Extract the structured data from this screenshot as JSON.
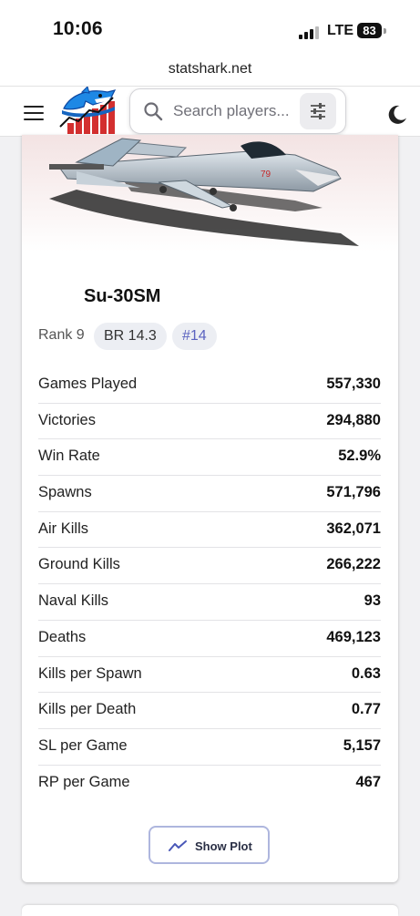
{
  "status_bar": {
    "time": "10:06",
    "network": "LTE",
    "battery": "83"
  },
  "browser": {
    "url": "statshark.net"
  },
  "header": {
    "menu_icon": "menu-icon",
    "logo_icon": "shark-logo-icon",
    "search": {
      "placeholder": "Search players...",
      "value": ""
    },
    "filter_icon": "sliders-icon",
    "theme_icon": "moon-icon"
  },
  "vehicle": {
    "name": "Su-30SM",
    "rank": "Rank 9",
    "br": "BR 14.3",
    "position": "#14"
  },
  "stats": [
    {
      "label": "Games Played",
      "value": "557,330"
    },
    {
      "label": "Victories",
      "value": "294,880"
    },
    {
      "label": "Win Rate",
      "value": "52.9%"
    },
    {
      "label": "Spawns",
      "value": "571,796"
    },
    {
      "label": "Air Kills",
      "value": "362,071"
    },
    {
      "label": "Ground Kills",
      "value": "266,222"
    },
    {
      "label": "Naval Kills",
      "value": "93"
    },
    {
      "label": "Deaths",
      "value": "469,123"
    },
    {
      "label": "Kills per Spawn",
      "value": "0.63"
    },
    {
      "label": "Kills per Death",
      "value": "0.77"
    },
    {
      "label": "SL per Game",
      "value": "5,157"
    },
    {
      "label": "RP per Game",
      "value": "467"
    }
  ],
  "plot_button": {
    "label": "Show Plot",
    "icon": "trend-line-icon"
  },
  "colors": {
    "accent": "#5b63c0",
    "button_border": "#aeb6de",
    "logo_red": "#d32f2f",
    "logo_blue": "#1e88e5"
  }
}
